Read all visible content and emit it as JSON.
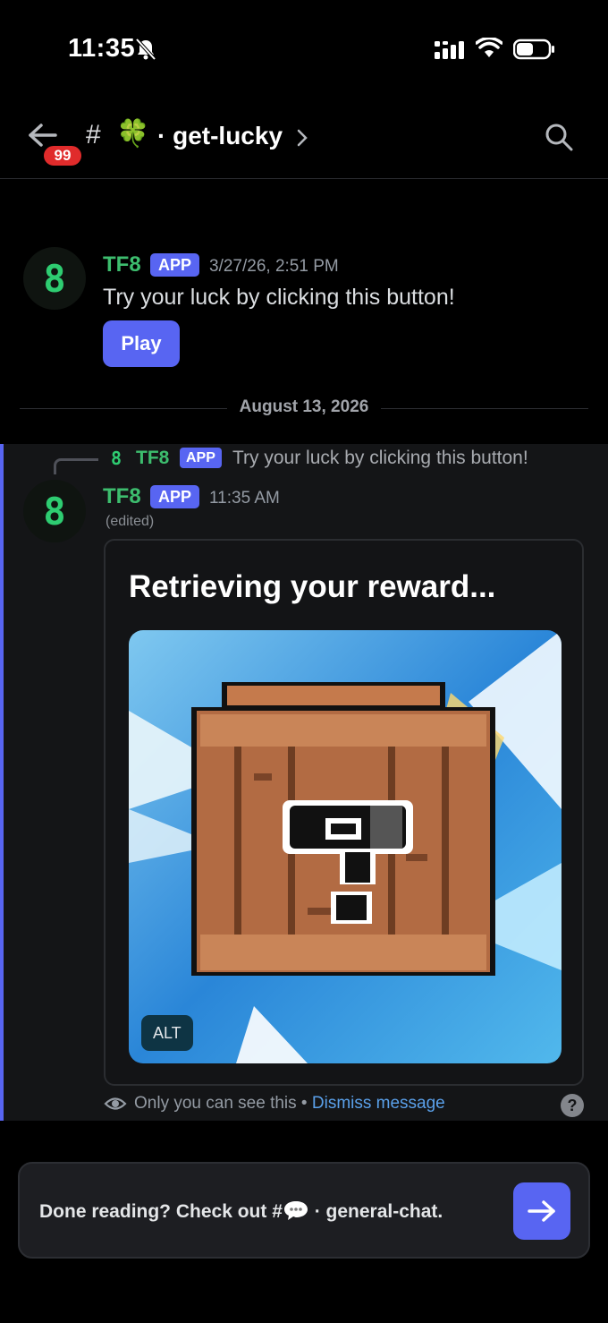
{
  "status_bar": {
    "time": "11:35"
  },
  "header": {
    "badge_count": "99",
    "hash": "#",
    "channel_emoji": "🍀",
    "channel_name": "· get-lucky"
  },
  "messages": [
    {
      "author": "TF8",
      "tag": "APP",
      "avatar_glyph": "8",
      "timestamp": "3/27/26, 2:51 PM",
      "text": "Try your luck by clicking this button!",
      "button_label": "Play"
    }
  ],
  "date_divider": "August 13, 2026",
  "ephemeral": {
    "reply": {
      "avatar_glyph": "8",
      "author": "TF8",
      "tag": "APP",
      "text": "Try your luck by clicking this button!"
    },
    "author": "TF8",
    "tag": "APP",
    "avatar_glyph": "8",
    "timestamp": "11:35 AM",
    "edited_label": "(edited)",
    "embed_title": "Retrieving your reward...",
    "alt_label": "ALT",
    "visibility_text": "Only you can see this",
    "separator": " • ",
    "dismiss_label": "Dismiss message",
    "help_glyph": "?"
  },
  "next_channel": {
    "prefix": "Done reading? Check out #",
    "channel": " · general-chat."
  },
  "colors": {
    "accent": "#5865f2",
    "author_green": "#3dbd6e",
    "badge_red": "#e02b2b",
    "link_blue": "#5aa0ea"
  }
}
